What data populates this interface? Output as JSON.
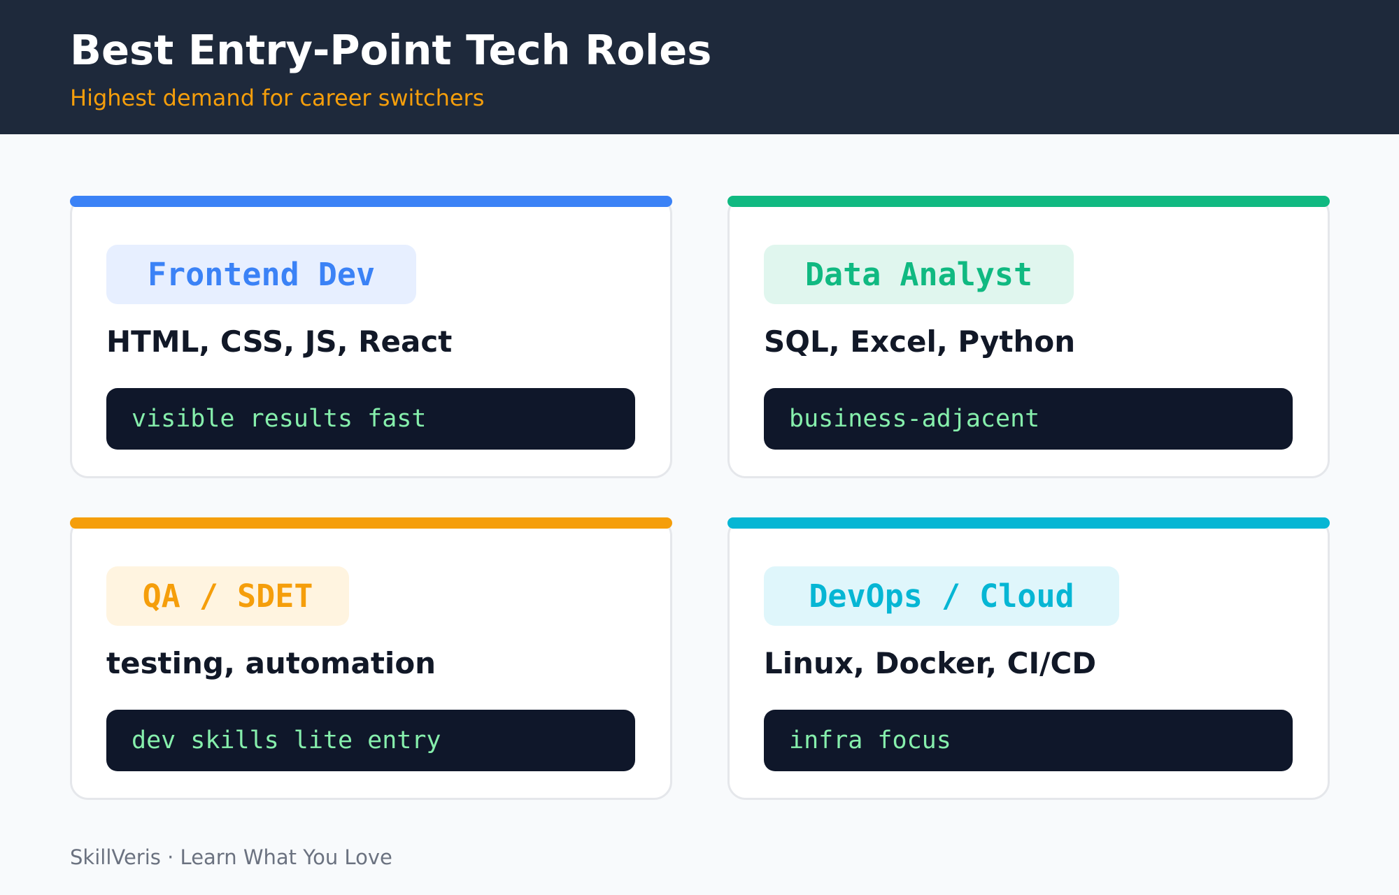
{
  "header": {
    "title": "Best Entry-Point Tech Roles",
    "subtitle": "Highest demand for career switchers"
  },
  "cards": [
    {
      "role": "Frontend Dev",
      "skills": "HTML, CSS, JS, React",
      "note": "visible results fast",
      "accent": "#3b82f6",
      "tag_bg": "#e7efff"
    },
    {
      "role": "Data Analyst",
      "skills": "SQL, Excel, Python",
      "note": "business-adjacent",
      "accent": "#10b981",
      "tag_bg": "#e0f6ee"
    },
    {
      "role": "QA / SDET",
      "skills": "testing, automation",
      "note": "dev skills lite entry",
      "accent": "#f59e0b",
      "tag_bg": "#fff4e0"
    },
    {
      "role": "DevOps / Cloud",
      "skills": "Linux, Docker, CI/CD",
      "note": "infra focus",
      "accent": "#06b6d4",
      "tag_bg": "#dff6fb"
    }
  ],
  "footer": {
    "text": "SkillVeris · Learn What You Love"
  }
}
